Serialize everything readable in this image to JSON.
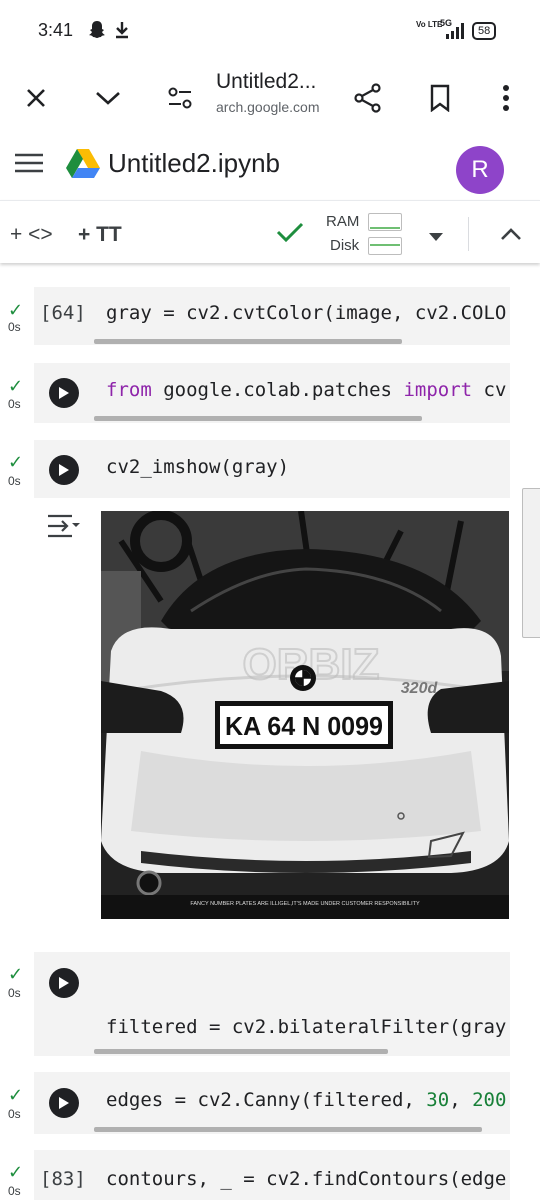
{
  "status_bar": {
    "time": "3:41",
    "network": "5G",
    "volte": "Vo LTE",
    "battery": "58"
  },
  "browser": {
    "title": "Untitled2...",
    "url": "arch.google.com"
  },
  "colab": {
    "notebook_name": "Untitled2.ipynb",
    "avatar_letter": "R"
  },
  "toolbar": {
    "add_code": "+ <>",
    "add_text": "+ TT",
    "ram_label": "RAM",
    "disk_label": "Disk"
  },
  "cells": [
    {
      "exec": "[64]",
      "time": "0s",
      "code": "gray = cv2.cvtColor(image, cv2.COLO"
    },
    {
      "time": "0s",
      "code_kw1": "from",
      "code_mid": " google.colab.patches ",
      "code_kw2": "import",
      "code_tail": " cv"
    },
    {
      "time": "0s",
      "code": "cv2_imshow(gray)"
    },
    {
      "time": "0s",
      "code": "filtered = cv2.bilateralFilter(gray"
    },
    {
      "time": "0s",
      "code_pre": "edges = cv2.Canny(filtered, ",
      "num1": "30",
      "code_sep": ", ",
      "num2": "200"
    },
    {
      "exec": "[83]",
      "time": "0s",
      "code": "contours, _ = cv2.findContours(edge"
    }
  ],
  "output_image": {
    "plate_text": "KA 64 N 0099",
    "watermark": "ORBIZ",
    "badge": "320d",
    "disclaimer": "FANCY NUMBER PLATES ARE ILLIGEL,IT'S MADE UNDER CUSTOMER RESPONSIBILITY"
  },
  "colors": {
    "check_green": "#1e8e3e",
    "avatar_purple": "#8e44c9",
    "keyword_purple": "#8e24aa",
    "number_green": "#188038"
  }
}
